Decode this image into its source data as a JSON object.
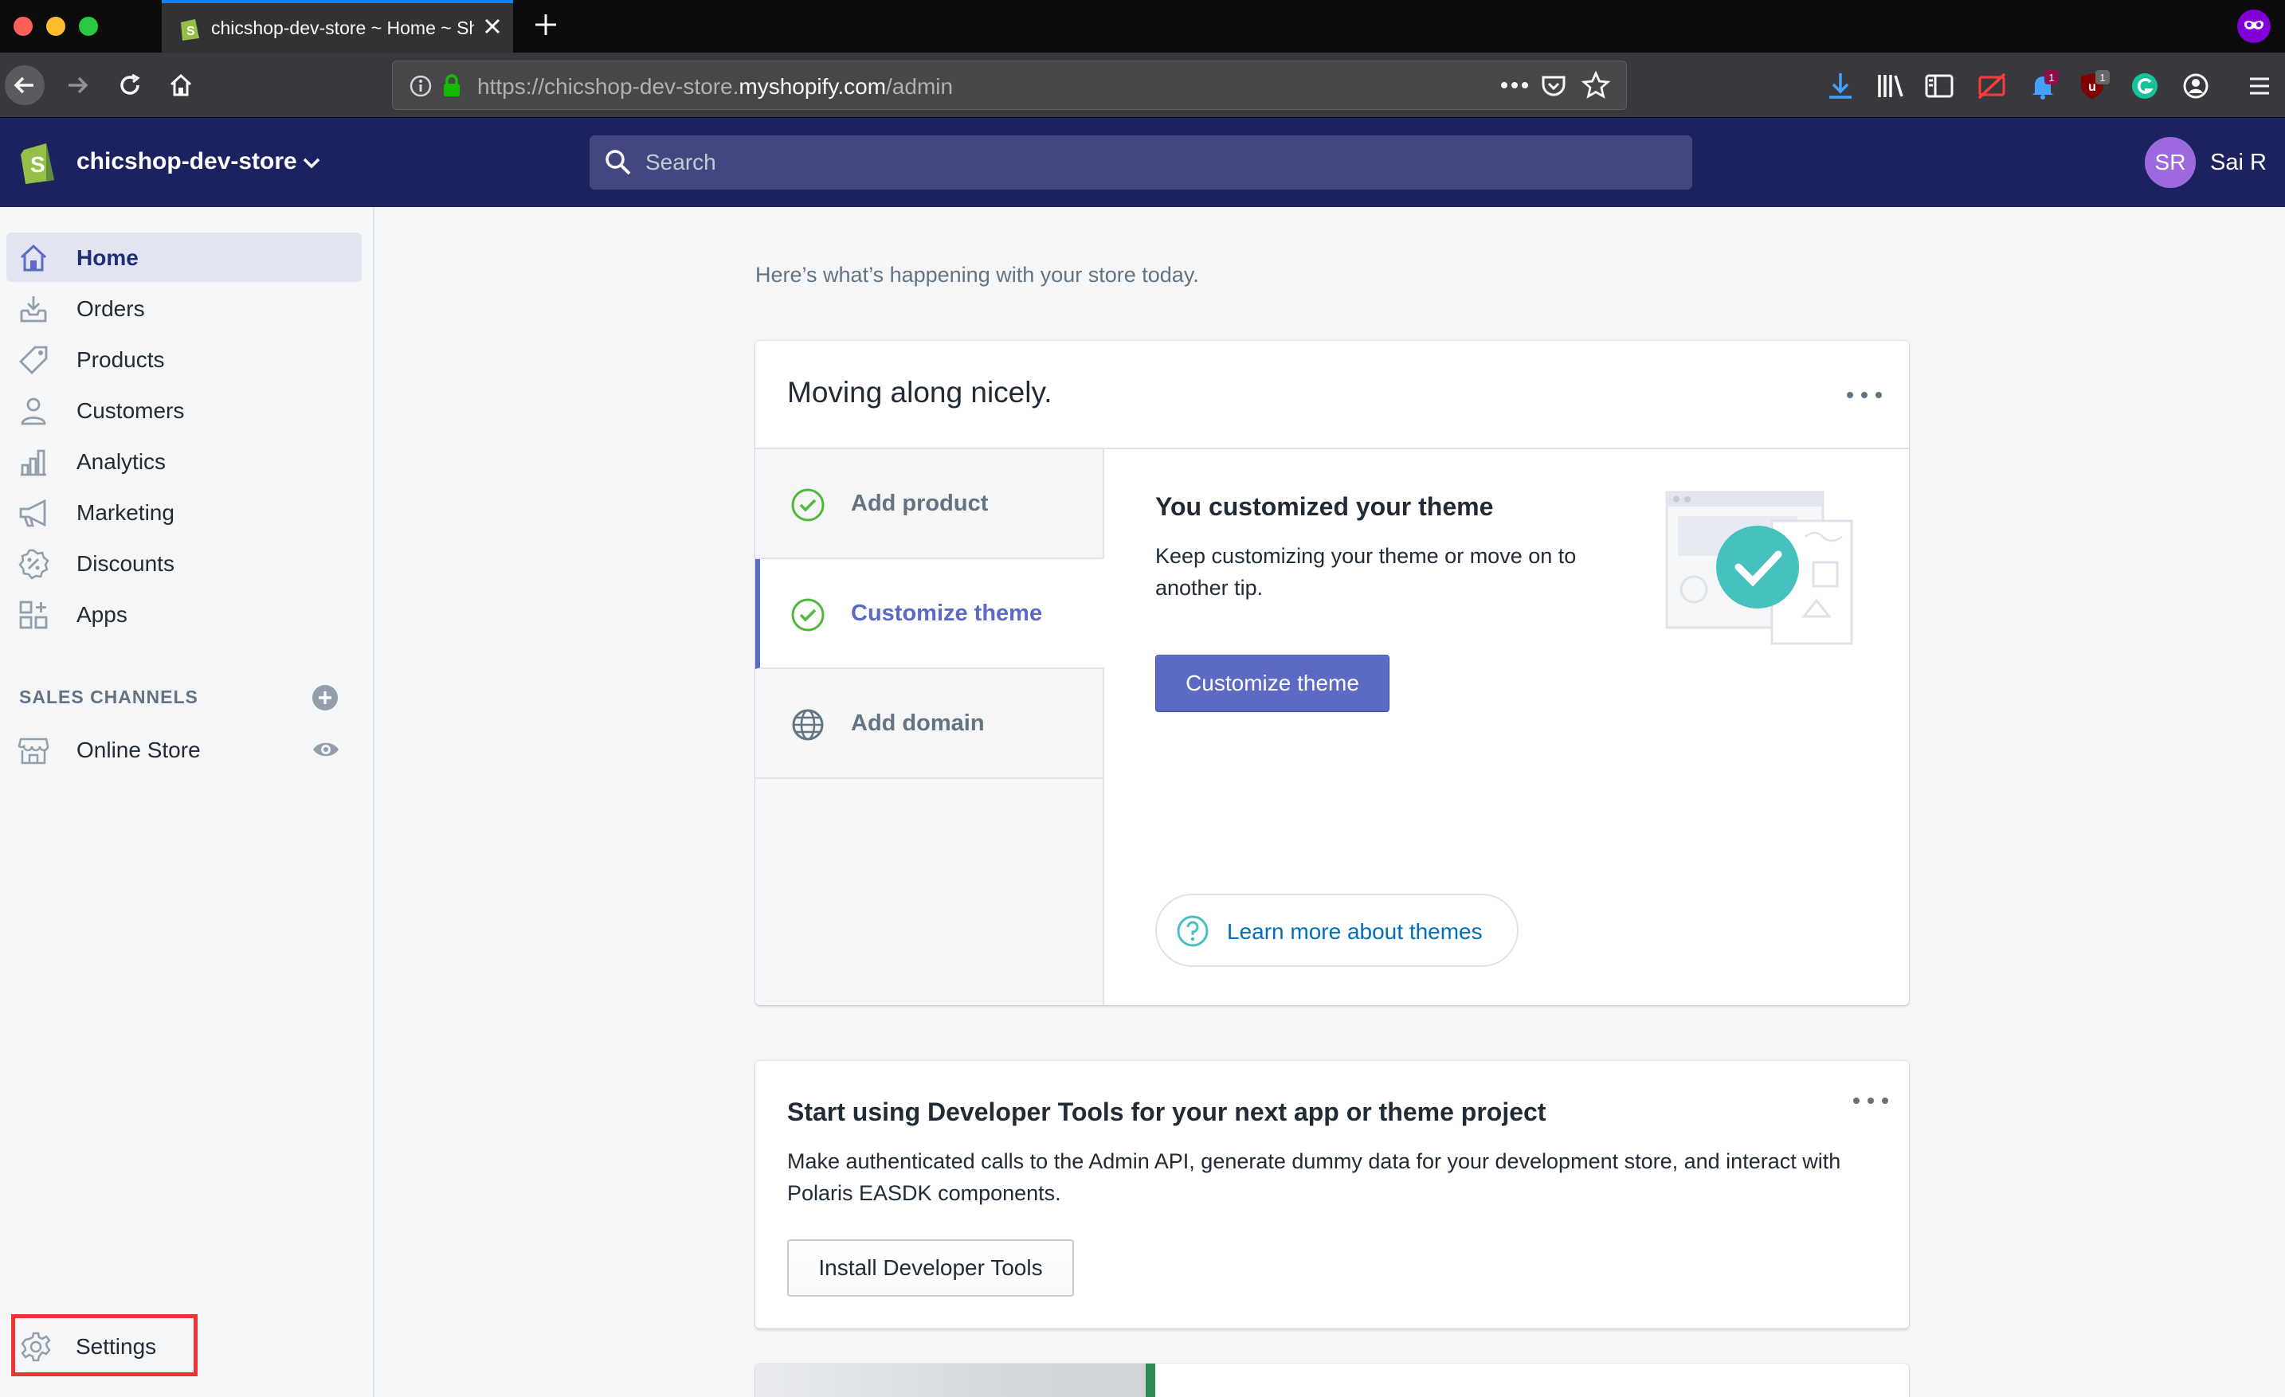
{
  "browser": {
    "tab_title": "chicshop-dev-store ~ Home ~ Shopify",
    "url_prefix": "https://chicshop-dev-store.",
    "url_domain": "myshopify.com",
    "url_path": "/admin",
    "badges": {
      "bell": "1",
      "ublock": "1"
    }
  },
  "topbar": {
    "store_name": "chicshop-dev-store",
    "search_placeholder": "Search",
    "user_initials": "SR",
    "user_name": "Sai R"
  },
  "sidebar": {
    "items": [
      {
        "label": "Home",
        "icon": "home-icon",
        "active": true
      },
      {
        "label": "Orders",
        "icon": "orders-icon"
      },
      {
        "label": "Products",
        "icon": "tag-icon"
      },
      {
        "label": "Customers",
        "icon": "person-icon"
      },
      {
        "label": "Analytics",
        "icon": "bar-chart-icon"
      },
      {
        "label": "Marketing",
        "icon": "megaphone-icon"
      },
      {
        "label": "Discounts",
        "icon": "discount-icon"
      },
      {
        "label": "Apps",
        "icon": "apps-icon"
      }
    ],
    "sales_channels_header": "SALES CHANNELS",
    "channels": [
      {
        "label": "Online Store",
        "icon": "store-icon"
      }
    ],
    "settings_label": "Settings"
  },
  "main": {
    "intro": "Here’s what’s happening with your store today.",
    "setup_card": {
      "title": "Moving along nicely.",
      "steps": [
        {
          "label": "Add product",
          "state": "complete"
        },
        {
          "label": "Customize theme",
          "state": "complete",
          "active": true
        },
        {
          "label": "Add domain",
          "state": "pending"
        }
      ],
      "tip_title": "You customized your theme",
      "tip_description": "Keep customizing your theme or move on to another tip.",
      "primary_button": "Customize theme",
      "learn_more": "Learn more about themes"
    },
    "dev_card": {
      "title": "Start using Developer Tools for your next app or theme project",
      "description": "Make authenticated calls to the Admin API, generate dummy data for your development store, and interact with Polaris EASDK components.",
      "button": "Install Developer Tools"
    }
  },
  "colors": {
    "topbar": "#1c2260",
    "accent": "#5c6ac4",
    "success": "#50b83c",
    "link": "#006fbb",
    "highlight": "#ee3333"
  }
}
